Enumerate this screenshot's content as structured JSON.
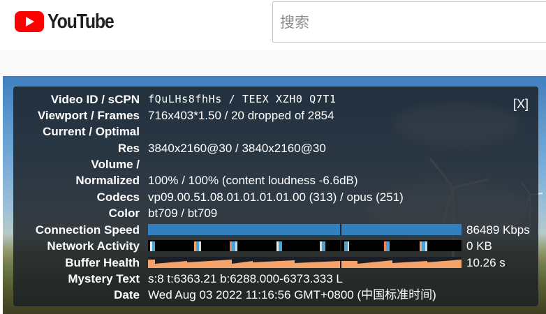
{
  "header": {
    "logo_text": "YouTube",
    "search_placeholder": "搜索",
    "brand_color": "#ff0000"
  },
  "stats": {
    "close_label": "[X]",
    "rows": [
      {
        "label": "Video ID / sCPN",
        "value": "fQuLHs8fhHs / TEEX XZH0 Q7T1"
      },
      {
        "label": "Viewport / Frames",
        "value": "716x403*1.50 / 20 dropped of 2854"
      },
      {
        "label": "Current / Optimal",
        "value": ""
      },
      {
        "label": "Res",
        "value": "3840x2160@30 / 3840x2160@30"
      },
      {
        "label": "Volume /",
        "value": ""
      },
      {
        "label": "Normalized",
        "value": "100% / 100% (content loudness -6.6dB)"
      },
      {
        "label": "Codecs",
        "value": "vp09.00.51.08.01.01.01.01.00 (313) / opus (251)"
      },
      {
        "label": "Color",
        "value": "bt709 / bt709"
      },
      {
        "label": "Connection Speed",
        "value": "86489 Kbps"
      },
      {
        "label": "Network Activity",
        "value": "0 KB"
      },
      {
        "label": "Buffer Health",
        "value": "10.26 s"
      },
      {
        "label": "Mystery Text",
        "value": "s:8 t:6363.21 b:6288.000-6373.333 L"
      },
      {
        "label": "Date",
        "value": "Wed Aug 03 2022 11:16:56 GMT+0800 (中国标准时间)"
      }
    ],
    "colors": {
      "connection_bar": "#2f7fc1",
      "network_bg": "#000000",
      "buffer_fill": "#f4a46a"
    }
  }
}
